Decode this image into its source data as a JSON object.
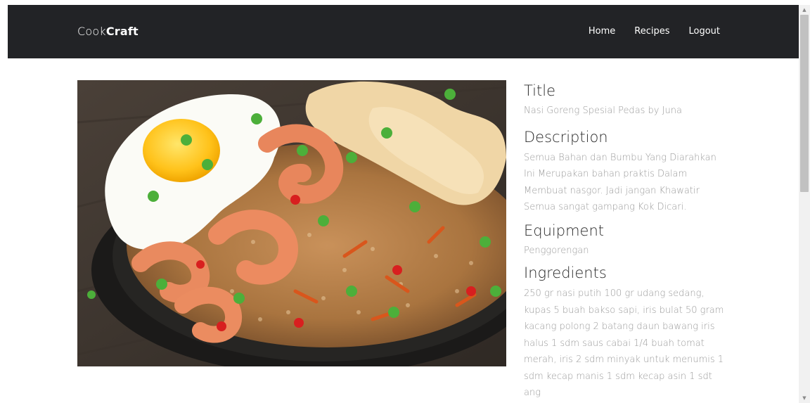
{
  "brand": {
    "part1": "Cook",
    "part2": "Craft"
  },
  "nav": [
    {
      "label": "Home"
    },
    {
      "label": "Recipes"
    },
    {
      "label": "Logout"
    }
  ],
  "recipe": {
    "title_heading": "Title",
    "title_value": "Nasi Goreng Spesial Pedas by Juna",
    "description_heading": "Description",
    "description_value": "Semua Bahan dan Bumbu Yang Diarahkan Ini Merupakan bahan praktis Dalam Membuat nasgor. Jadi jangan Khawatir Semua sangat gampang Kok Dicari.",
    "equipment_heading": "Equipment",
    "equipment_value": "Penggorengan",
    "ingredients_heading": "Ingredients",
    "ingredients_value": "250 gr nasi putih 100 gr udang sedang, kupas 5 buah bakso sapi, iris bulat 50 gram kacang polong 2 batang daun bawang iris halus 1 sdm saus cabai 1/4 buah tomat merah, iris 2 sdm minyak untuk menumis 1 sdm kecap manis 1 sdm kecap asin 1 sdt ang"
  },
  "colors": {
    "navbar": "#222326",
    "heading": "#2b2b2b",
    "muted_text": "#9b9b9b"
  },
  "icons": {
    "scroll_up": "arrow-up-icon",
    "scroll_down": "arrow-down-icon"
  }
}
